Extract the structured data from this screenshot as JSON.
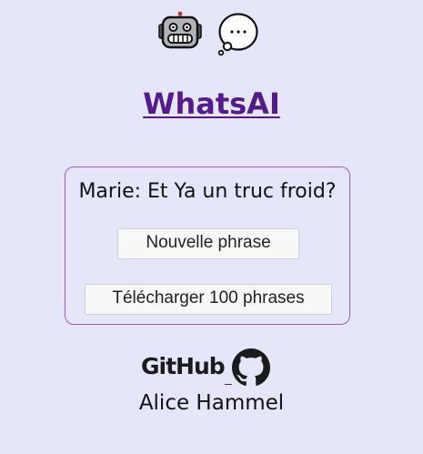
{
  "header": {
    "icons": [
      "robot-icon",
      "thought-bubble-icon"
    ],
    "title": "WhatsAI"
  },
  "card": {
    "phrase": "Marie: Et Ya un truc froid?",
    "new_phrase_label": "Nouvelle phrase",
    "download_label": "Télécharger 100 phrases"
  },
  "footer": {
    "github_label": "GitHub",
    "author": "Alice Hammel"
  },
  "colors": {
    "background": "#e6e6fa",
    "title_link": "#551a8b",
    "card_border": "#9b59d0"
  }
}
